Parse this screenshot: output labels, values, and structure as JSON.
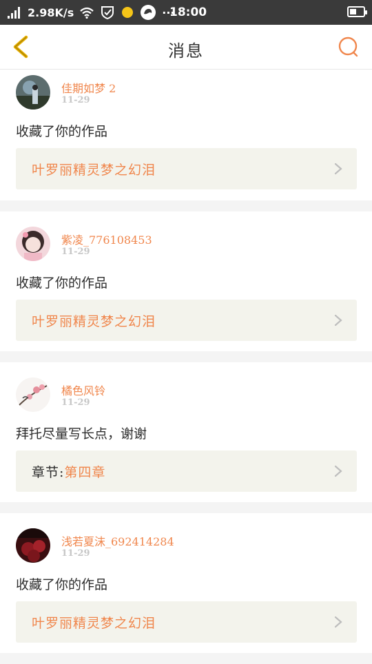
{
  "status_bar": {
    "speed": "2.98K/s",
    "time": "18:00",
    "more": "···"
  },
  "header": {
    "title": "消息"
  },
  "messages": [
    {
      "username": "佳期如梦 2",
      "date": "11-29",
      "action": "收藏了你的作品",
      "link_prefix": "",
      "link_text": "叶罗丽精灵梦之幻泪"
    },
    {
      "username": "紫凌_776108453",
      "date": "11-29",
      "action": "收藏了你的作品",
      "link_prefix": "",
      "link_text": "叶罗丽精灵梦之幻泪"
    },
    {
      "username": "橘色风铃",
      "date": "11-29",
      "action": "拜托尽量写长点，谢谢",
      "link_prefix": "章节:",
      "link_text": "第四章"
    },
    {
      "username": "浅若夏沫_692414284",
      "date": "11-29",
      "action": "收藏了你的作品",
      "link_prefix": "",
      "link_text": "叶罗丽精灵梦之幻泪"
    }
  ],
  "colors": {
    "accent": "#f0864c",
    "back_icon": "#e8b000",
    "status_bg": "#3a3a3a"
  }
}
